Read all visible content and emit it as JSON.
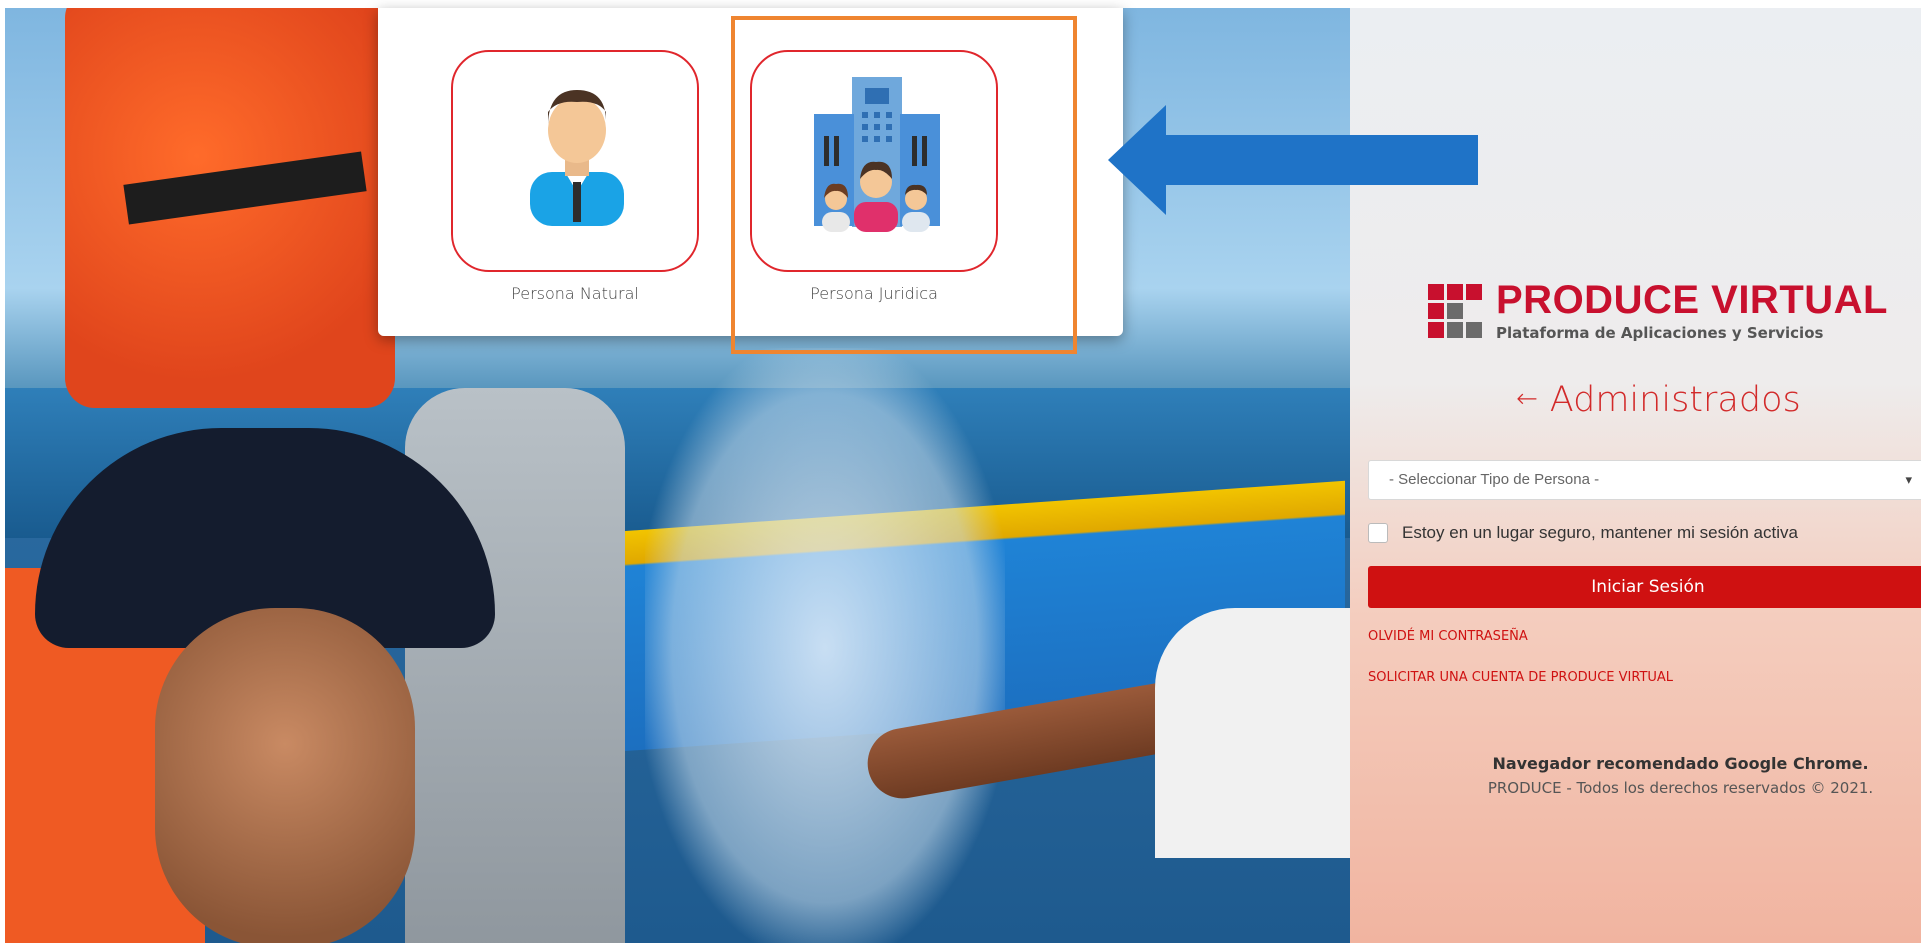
{
  "options_card": {
    "items": [
      {
        "label": "Persona Natural",
        "icon": "person-icon"
      },
      {
        "label": "Persona Juridica",
        "icon": "company-building-icon"
      }
    ]
  },
  "annotations": {
    "highlight_color": "#ef8530",
    "arrow_color": "#1f73c7",
    "arrow_icon": "left-arrow-icon"
  },
  "login_panel": {
    "brand_title": "PRODUCE VIRTUAL",
    "brand_subtitle": "Plataforma de Aplicaciones y Servicios",
    "back_arrow": "←",
    "title": "Administrados",
    "select_placeholder": "- Seleccionar Tipo de Persona -",
    "remember_label": "Estoy en un lugar seguro, mantener mi sesión activa",
    "login_button": "Iniciar Sesión",
    "forgot_password_link": "OLVIDÉ MI CONTRASEÑA",
    "request_account_link": "SOLICITAR UNA CUENTA DE PRODUCE VIRTUAL",
    "footer_browser": "Navegador recomendado Google Chrome.",
    "footer_rights": "PRODUCE - Todos los derechos reservados © 2021.",
    "accent_color": "#cf1111"
  }
}
